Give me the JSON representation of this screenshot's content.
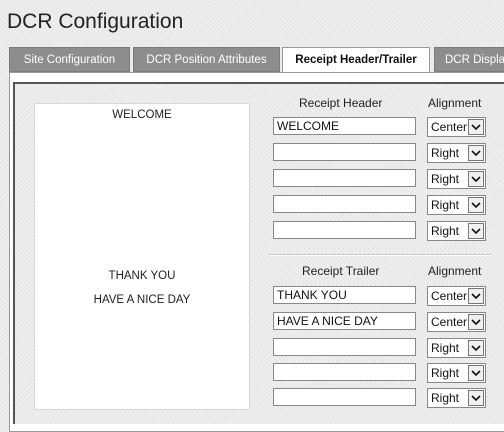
{
  "page": {
    "title": "DCR Configuration"
  },
  "tabs": [
    {
      "label": "Site Configuration",
      "active": false
    },
    {
      "label": "DCR Position Attributes",
      "active": false
    },
    {
      "label": "Receipt Header/Trailer",
      "active": true
    },
    {
      "label": "DCR Display",
      "active": false
    }
  ],
  "preview": {
    "header_lines": [
      "WELCOME"
    ],
    "trailer_lines": [
      "THANK YOU",
      "HAVE A NICE DAY"
    ]
  },
  "header": {
    "col_text": "Receipt Header",
    "col_align": "Alignment",
    "rows": [
      {
        "value": "WELCOME",
        "align": "Center"
      },
      {
        "value": "",
        "align": "Right"
      },
      {
        "value": "",
        "align": "Right"
      },
      {
        "value": "",
        "align": "Right"
      },
      {
        "value": "",
        "align": "Right"
      }
    ]
  },
  "trailer": {
    "col_text": "Receipt Trailer",
    "col_align": "Alignment",
    "rows": [
      {
        "value": "THANK YOU",
        "align": "Center"
      },
      {
        "value": "HAVE A NICE DAY",
        "align": "Center"
      },
      {
        "value": "",
        "align": "Right"
      },
      {
        "value": "",
        "align": "Right"
      },
      {
        "value": "",
        "align": "Right"
      }
    ]
  },
  "icons": {
    "dropdown": "chevron-down-icon"
  }
}
